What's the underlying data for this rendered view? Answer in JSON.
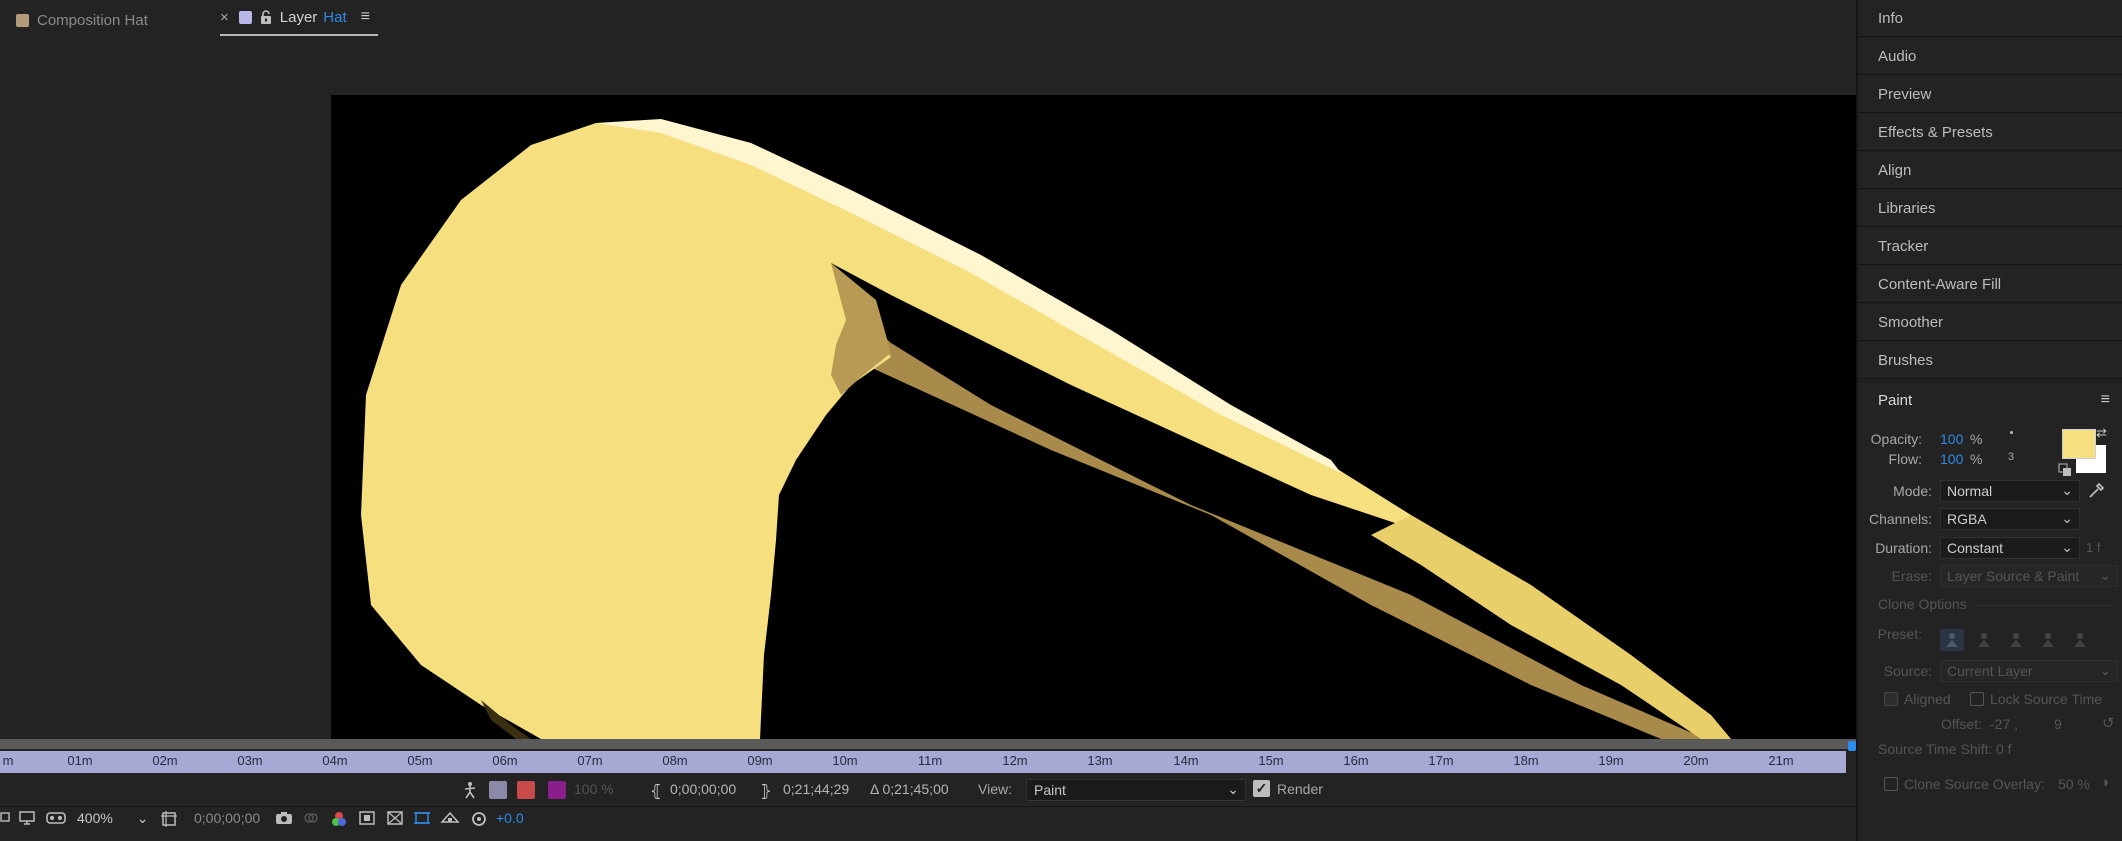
{
  "tabs": {
    "composition": {
      "label": "Composition Hat",
      "swatch_color": "#b49a7b"
    },
    "layer": {
      "label": "Layer",
      "name": "Hat",
      "swatch_color": "#b9b6e8"
    }
  },
  "viewer": {
    "artwork_colors": {
      "hat_fill": "#f6df7e",
      "shadow": "#a88a4a",
      "highlight": "#fff6cf",
      "background": "#000000"
    }
  },
  "ruler": {
    "ticks": [
      "m",
      "01m",
      "02m",
      "03m",
      "04m",
      "05m",
      "06m",
      "07m",
      "08m",
      "09m",
      "10m",
      "11m",
      "12m",
      "13m",
      "14m",
      "15m",
      "16m",
      "17m",
      "18m",
      "19m",
      "20m",
      "21m"
    ]
  },
  "controls": {
    "opacity_value": "100 %",
    "time_start": "0;00;00;00",
    "time_end": "0;21;44;29",
    "time_duration": "Δ 0;21;45;00",
    "view_label": "View:",
    "view_value": "Paint",
    "render_label": "Render",
    "zoom": "400%",
    "timecode": "0;00;00;00",
    "exposure": "+0.0"
  },
  "panels": [
    "Info",
    "Audio",
    "Preview",
    "Effects & Presets",
    "Align",
    "Libraries",
    "Tracker",
    "Content-Aware Fill",
    "Smoother",
    "Brushes"
  ],
  "paint": {
    "title": "Paint",
    "opacity_label": "Opacity:",
    "opacity_value": "100",
    "flow_label": "Flow:",
    "flow_value": "100",
    "percent": "%",
    "brush_size": "3",
    "mode_label": "Mode:",
    "mode_value": "Normal",
    "channels_label": "Channels:",
    "channels_value": "RGBA",
    "duration_label": "Duration:",
    "duration_value": "Constant",
    "duration_frames": "1 f",
    "erase_label": "Erase:",
    "erase_value": "Layer Source & Paint",
    "clone_options": "Clone Options",
    "preset_label": "Preset:",
    "source_label": "Source:",
    "source_value": "Current Layer",
    "aligned_label": "Aligned",
    "lock_source_time_label": "Lock Source Time",
    "offset_label": "Offset:",
    "offset_x": "-27 ,",
    "offset_y": "9",
    "source_time_shift_label": "Source Time Shift:",
    "source_time_shift_value": "0 f",
    "clone_source_overlay_label": "Clone Source Overlay:",
    "clone_source_overlay_value": "50 %",
    "fg_color": "#f6df80",
    "bg_color": "#ffffff"
  }
}
